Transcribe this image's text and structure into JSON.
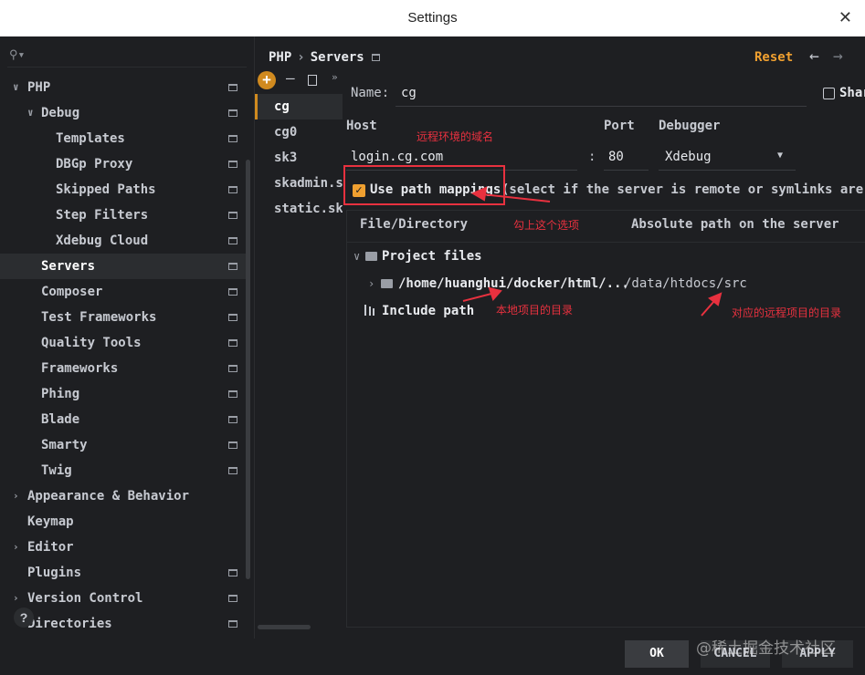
{
  "window": {
    "title": "Settings",
    "close": "✕"
  },
  "search": {
    "icon": "search-icon"
  },
  "sidebar": {
    "items": [
      {
        "label": "PHP",
        "arrow": "∨",
        "gear": true
      },
      {
        "label": "Debug",
        "arrow": "∨",
        "gear": true
      },
      {
        "label": "Templates",
        "gear": true
      },
      {
        "label": "DBGp Proxy",
        "gear": true
      },
      {
        "label": "Skipped Paths",
        "gear": true
      },
      {
        "label": "Step Filters",
        "gear": true
      },
      {
        "label": "Xdebug Cloud",
        "gear": true
      },
      {
        "label": "Servers",
        "gear": true,
        "selected": true
      },
      {
        "label": "Composer",
        "gear": true
      },
      {
        "label": "Test Frameworks",
        "gear": true
      },
      {
        "label": "Quality Tools",
        "gear": true
      },
      {
        "label": "Frameworks",
        "gear": true
      },
      {
        "label": "Phing",
        "gear": true
      },
      {
        "label": "Blade",
        "gear": true
      },
      {
        "label": "Smarty",
        "gear": true
      },
      {
        "label": "Twig",
        "gear": true
      },
      {
        "label": "Appearance & Behavior",
        "arrow": "›"
      },
      {
        "label": "Keymap"
      },
      {
        "label": "Editor",
        "arrow": "›"
      },
      {
        "label": "Plugins",
        "gear": true
      },
      {
        "label": "Version Control",
        "arrow": "›",
        "gear": true
      },
      {
        "label": "Directories",
        "gear": true
      }
    ],
    "help": "?"
  },
  "servers": {
    "toolbar": {
      "add": "+",
      "remove": "—",
      "more": "»"
    },
    "items": [
      "cg",
      "cg0",
      "sk3",
      "skadmin.sk",
      "static.sk"
    ]
  },
  "header": {
    "crumb_root": "PHP",
    "crumb_sep": "›",
    "crumb_leaf": "Servers",
    "reset": "Reset",
    "back": "←",
    "forward": "→"
  },
  "form": {
    "name_label": "Name:",
    "name_value": "cg",
    "share_label": "Shar",
    "host_label": "Host",
    "host_value": "login.cg.com",
    "port_label": "Port",
    "port_sep": ":",
    "port_value": "80",
    "debugger_label": "Debugger",
    "debugger_value": "Xdebug",
    "use_mappings_label": "Use path mappings",
    "use_mappings_hint": "(select if the server is remote or symlinks are us",
    "check_mark": "✓"
  },
  "mappings": {
    "col_file": "File/Directory",
    "col_server": "Absolute path on the server",
    "project_files": "Project files",
    "local_path": "/home/huanghui/docker/html/...",
    "server_path": "/data/htdocs/src",
    "include_path": "Include path"
  },
  "annotations": {
    "domain_note": "远程环境的域名",
    "check_note": "勾上这个选项",
    "local_note": "本地项目的目录",
    "remote_note": "对应的远程项目的目录",
    "color": "#e8313f"
  },
  "buttons": {
    "ok": "OK",
    "cancel": "CANCEL",
    "apply": "APPLY"
  },
  "watermark": "@稀土掘金技术社区",
  "colors": {
    "accent": "#f0a030",
    "add_button": "#d08a1f",
    "background": "#1e1f22"
  }
}
